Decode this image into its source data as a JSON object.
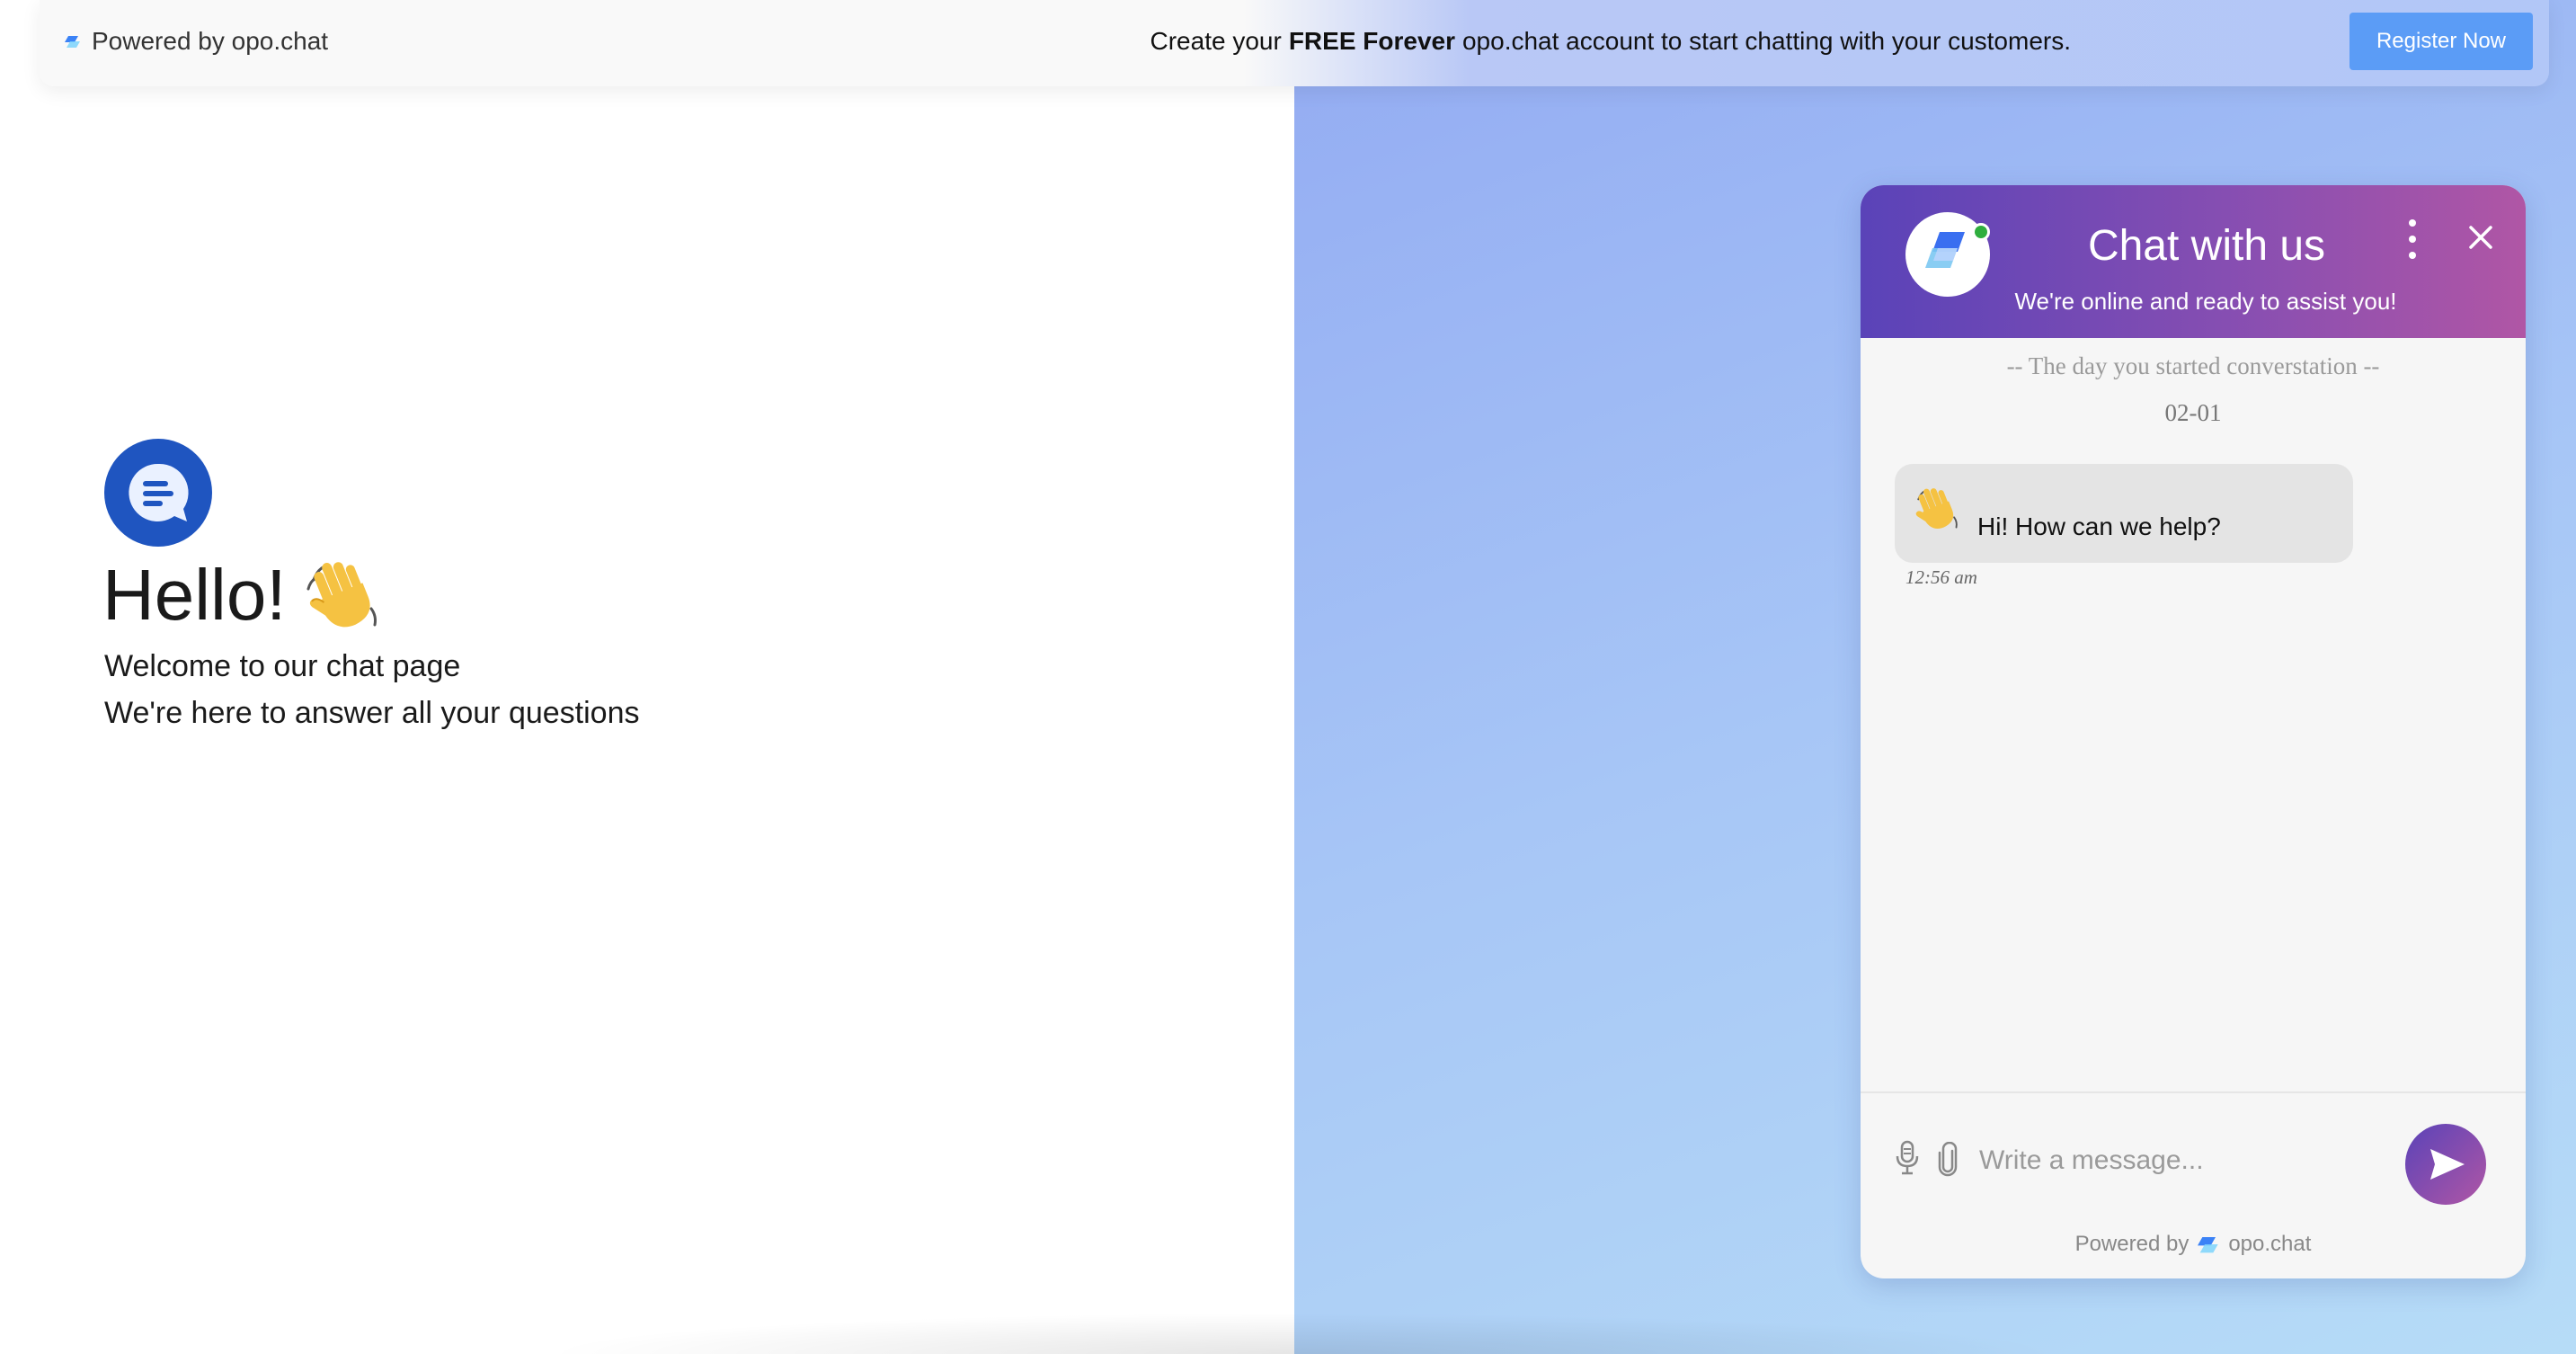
{
  "banner": {
    "powered_by": "Powered by opo.chat",
    "promo_before": "Create your",
    "promo_bold": "FREE Forever",
    "promo_after": "opo.chat account to start chatting with your customers.",
    "register_label": "Register Now",
    "register_color": "#5b9cf6"
  },
  "hero": {
    "title": "Hello!",
    "line1": "Welcome to our chat page",
    "line2": "We're here to answer all your questions"
  },
  "widget": {
    "title": "Chat with us",
    "subtitle": "We're online and ready to assist you!",
    "status": "online",
    "day_label": "-- The day you started converstation --",
    "date": "02-01",
    "messages": [
      {
        "text": "Hi! How can we help?",
        "time": "12:56 am",
        "emoji": "waving-hand"
      }
    ],
    "input_placeholder": "Write a message...",
    "footer_prefix": "Powered by",
    "footer_brand": "opo.chat",
    "header_gradient": [
      "#5a43b8",
      "#b056a5"
    ]
  },
  "icons": [
    "opo-logo-icon",
    "chat-bubble-icon",
    "waving-hand-icon",
    "more-options-icon",
    "close-icon",
    "microphone-icon",
    "paperclip-icon",
    "send-icon"
  ]
}
